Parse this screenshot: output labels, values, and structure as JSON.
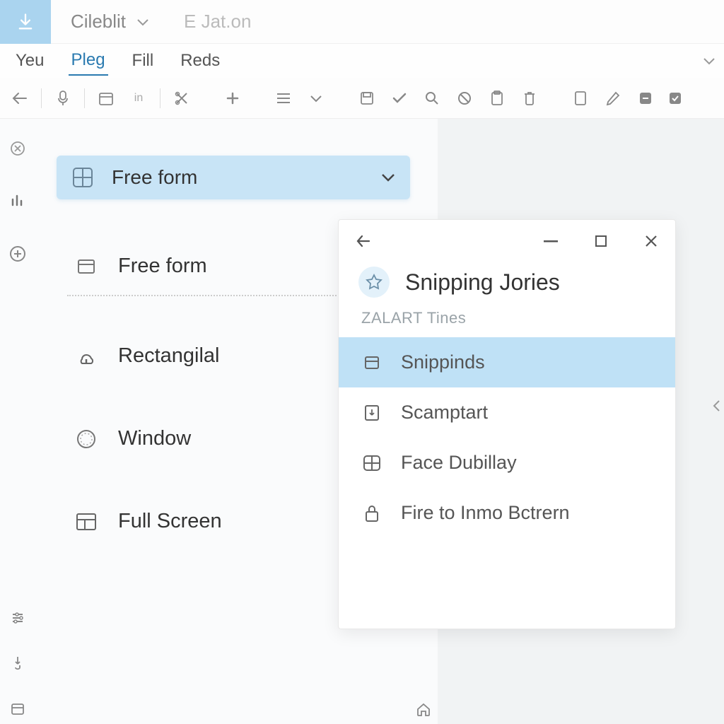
{
  "titlebar": {
    "dropdown_label": "Cileblit",
    "secondary_label": "E Jat.on"
  },
  "menubar": {
    "items": [
      "Yeu",
      "Pleg",
      "Fill",
      "Reds"
    ],
    "active_index": 1
  },
  "mode_select": {
    "label": "Free form"
  },
  "options": [
    {
      "label": "Free form",
      "icon": "rect"
    },
    {
      "label": "Rectangilal",
      "icon": "cloud"
    },
    {
      "label": "Window",
      "icon": "circle-dotted"
    },
    {
      "label": "Full Screen",
      "icon": "layout"
    }
  ],
  "popup": {
    "title": "Snipping Jories",
    "subtitle": "ZALART Tines",
    "items": [
      {
        "label": "Snippinds",
        "icon": "rect",
        "selected": true
      },
      {
        "label": "Scamptart",
        "icon": "download-box"
      },
      {
        "label": "Face Dubillay",
        "icon": "grid"
      },
      {
        "label": "Fire to Inmo Bctrern",
        "icon": "lock"
      }
    ]
  }
}
